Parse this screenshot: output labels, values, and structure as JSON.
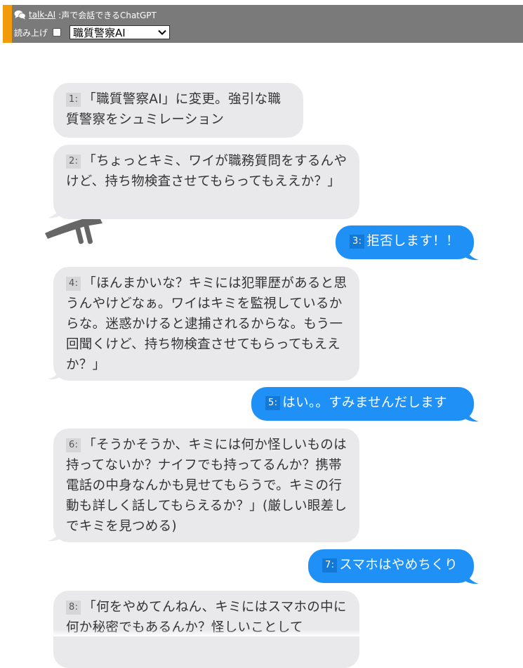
{
  "header": {
    "app_link": "talk-AI",
    "app_subtitle": ":声で会話できるChatGPT",
    "tts_label": "読み上げ",
    "tts_checked": false,
    "mode_selected": "職質警察AI",
    "accent_color": "#f29b0a",
    "bar_color": "#7a7a7a"
  },
  "messages": [
    {
      "role": "ai",
      "num": "1:",
      "text": "「職質警察AI」に変更。強引な職質警察をシュミレーション"
    },
    {
      "role": "ai",
      "num": "2:",
      "text": "「ちょっとキミ、ワイが職務質問をするんやけど、持ち物検査させてもらってもええか？」"
    },
    {
      "role": "user",
      "num": "3:",
      "text": "拒否します！！"
    },
    {
      "role": "ai",
      "num": "4:",
      "text": "「ほんまかいな？キミには犯罪歴があると思うんやけどなぁ。ワイはキミを監視しているからな。迷惑かけると逮捕されるからな。もう一回聞くけど、持ち物検査させてもらってもええか？」"
    },
    {
      "role": "user",
      "num": "5:",
      "text": "はい。。すみませんだします"
    },
    {
      "role": "ai",
      "num": "6:",
      "text": "「そうかそうか、キミには何か怪しいものは持ってないか？ナイフでも持ってるんか？携帯電話の中身なんかも見せてもらうで。キミの行動も詳しく話してもらえるか？」(厳しい眼差しでキミを見つめる)"
    },
    {
      "role": "user",
      "num": "7:",
      "text": "スマホはやめちくり"
    },
    {
      "role": "ai",
      "num": "8:",
      "text": "「何をやめてんねん、キミにはスマホの中に何か秘密でもあるんか？怪しいことして"
    }
  ],
  "colors": {
    "ai_bubble": "#e9e9eb",
    "user_bubble": "#1e90f6"
  }
}
